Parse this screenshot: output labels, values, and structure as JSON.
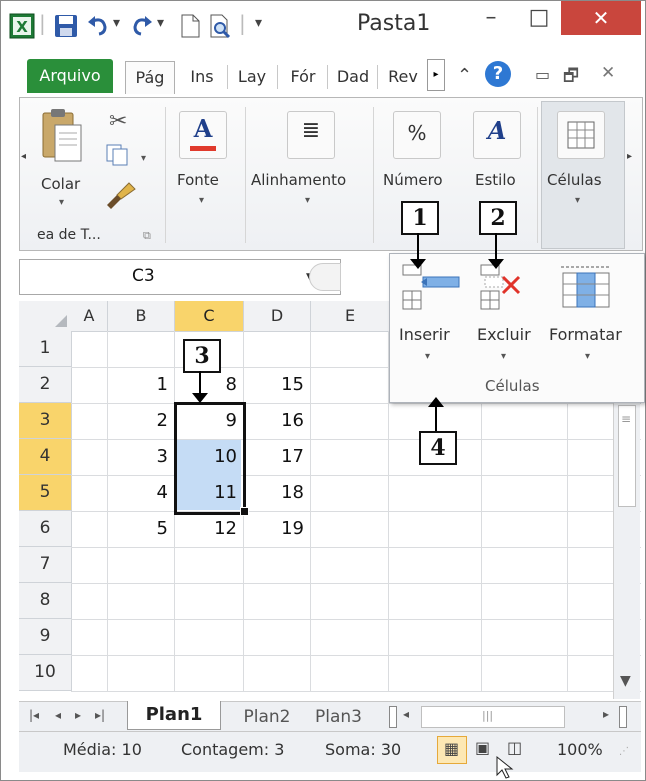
{
  "window": {
    "title": "Pasta1",
    "minimize": "–",
    "maximize": "□",
    "close": "✕",
    "qa_dropdown": "▾",
    "qa_separator": "|"
  },
  "tabs": [
    {
      "label": "Arquivo"
    },
    {
      "label": "Pág"
    },
    {
      "label": "Ins"
    },
    {
      "label": "Lay"
    },
    {
      "label": "Fór"
    },
    {
      "label": "Dad"
    },
    {
      "label": "Rev"
    }
  ],
  "tab_right_icons": {
    "up": "⌃",
    "help": "?",
    "min": "▭",
    "restore": "🗗",
    "close": "✕"
  },
  "ribbon": {
    "clipboard": {
      "paste": "Colar",
      "group": "ea de T..."
    },
    "fonte": "Fonte",
    "alinhamento": "Alinhamento",
    "numero": "Número",
    "numero_symbol": "%",
    "estilo": "Estilo",
    "celulas": "Células"
  },
  "namebox": {
    "value": "C3"
  },
  "columns": [
    "A",
    "B",
    "C",
    "D",
    "E"
  ],
  "rows": [
    "1",
    "2",
    "3",
    "4",
    "5",
    "6",
    "7",
    "8",
    "9",
    "10"
  ],
  "cells": {
    "B": [
      "",
      "1",
      "2",
      "3",
      "4",
      "5"
    ],
    "C": [
      "",
      "8",
      "9",
      "10",
      "11",
      "12"
    ],
    "D": [
      "",
      "15",
      "16",
      "17",
      "18",
      "19"
    ]
  },
  "panel": {
    "inserir": "Inserir",
    "excluir": "Excluir",
    "formatar": "Formatar",
    "group": "Células"
  },
  "callouts": [
    "1",
    "2",
    "3",
    "4"
  ],
  "sheets": [
    {
      "label": "Plan1"
    },
    {
      "label": "Plan2"
    },
    {
      "label": "Plan3"
    }
  ],
  "status": {
    "media": "Média: 10",
    "contagem": "Contagem: 3",
    "soma": "Soma: 30",
    "zoom": "100%"
  },
  "colors": {
    "accent_green": "#2a8f3a",
    "close_red": "#c9463d",
    "selected_header": "#f9d46b",
    "selection_fill": "#c5dcf5"
  }
}
